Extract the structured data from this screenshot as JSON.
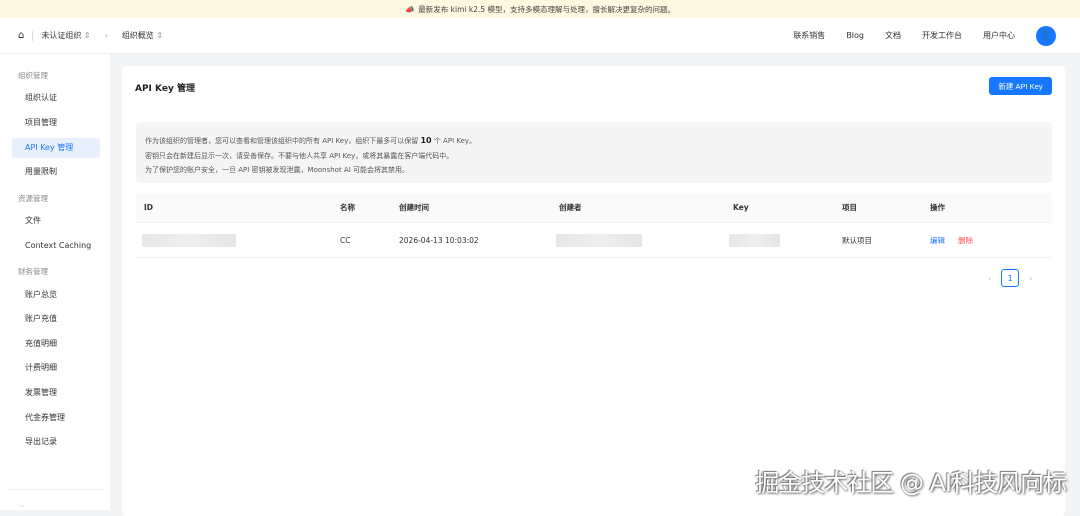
{
  "banner": {
    "icon": "megaphone-icon",
    "text": "最新发布 kimi k2.5 模型，支持多模态理解与处理，擅长解决更复杂的问题。"
  },
  "header": {
    "org": "未认证组织",
    "page": "组织概览",
    "nav": [
      "联系销售",
      "Blog",
      "文档",
      "开发工作台",
      "用户中心"
    ]
  },
  "sidebar": {
    "groups": [
      {
        "label": "组织管理",
        "items": [
          "组织认证",
          "项目管理",
          "API Key 管理",
          "用量限制"
        ]
      },
      {
        "label": "资源管理",
        "items": [
          "文件",
          "Context Caching"
        ]
      },
      {
        "label": "财务管理",
        "items": [
          "账户总览",
          "账户充值",
          "充值明细",
          "计费明细",
          "发票管理",
          "代金券管理",
          "导出记录"
        ]
      }
    ],
    "active": "API Key 管理"
  },
  "main": {
    "title": "API Key 管理",
    "new_button": "新建 API Key",
    "info": {
      "line1_a": "作为该组织的管理者，您可以查看和管理该组织中的所有 API Key，组织下最多可以保留",
      "line1_num": "10",
      "line1_b": "个 API Key。",
      "line2": "密钥只会在新建后显示一次，请妥善保存。不要与他人共享 API Key，或将其暴露在客户端代码中。",
      "line3": "为了保护您的账户安全，一旦 API 密钥被发现泄露，Moonshot AI 可能会将其禁用。"
    },
    "table": {
      "columns": [
        "ID",
        "名称",
        "创建时间",
        "创建者",
        "Key",
        "项目",
        "操作"
      ],
      "rows": [
        {
          "name": "CC",
          "created": "2026-04-13 10:03:02",
          "project": "默认项目",
          "edit": "编辑",
          "delete": "删除"
        }
      ]
    },
    "pagination": {
      "current": "1"
    }
  },
  "watermark": "掘金技术社区 @ AI科技风向标"
}
